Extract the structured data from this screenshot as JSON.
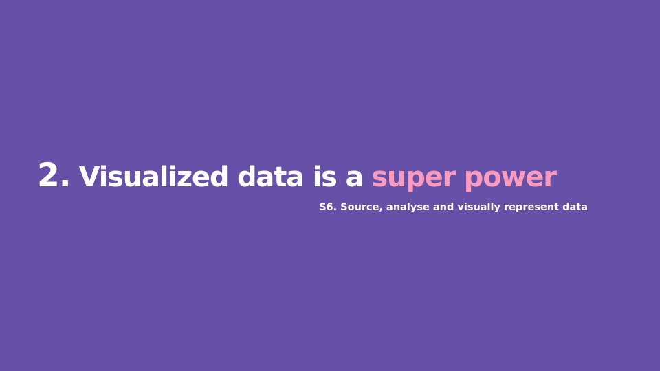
{
  "slide": {
    "section_number": "2.",
    "title_main": "Visualized data is a",
    "title_highlight": "super power",
    "subtitle": "S6. Source, analyse and visually represent data"
  },
  "colors": {
    "background": "#6750A8",
    "text": "#FFFFFF",
    "highlight": "#F99BBE"
  }
}
